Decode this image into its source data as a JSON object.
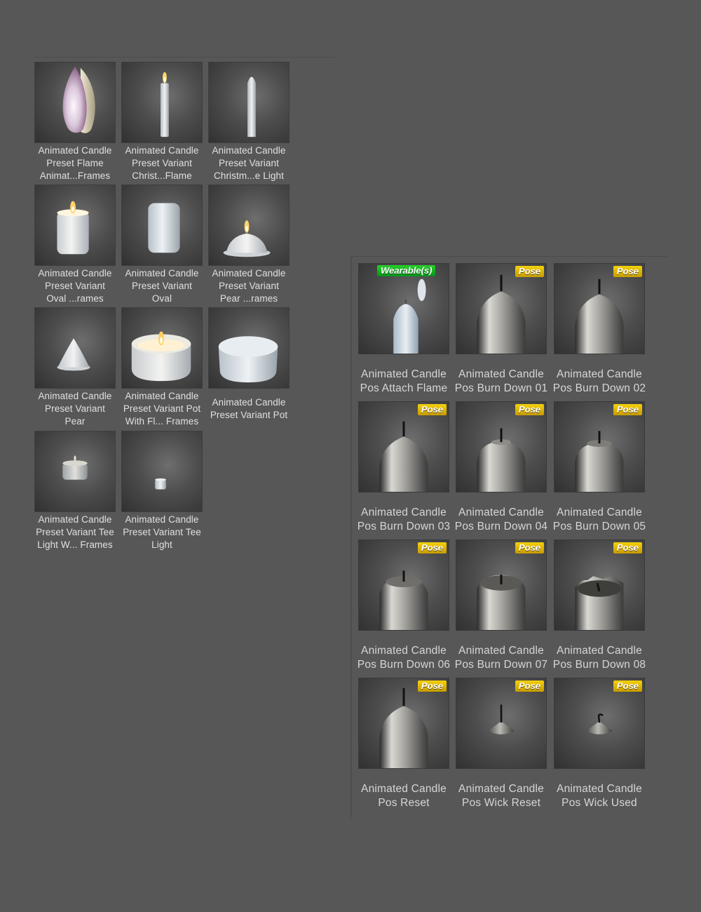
{
  "badge_colors": {
    "pose": "#e0b400",
    "wearable": "#17b21f"
  },
  "left_items": [
    {
      "line1": "Animated Candle",
      "line2": "Preset Flame",
      "line3": "Animat...Frames",
      "icon": "flame-icon"
    },
    {
      "line1": "Animated Candle",
      "line2": "Preset Variant",
      "line3": "Christ...Flame",
      "icon": "christmas-candle-flame-icon"
    },
    {
      "line1": "Animated Candle",
      "line2": "Preset Variant",
      "line3": "Christm...e Light",
      "icon": "christmas-candle-icon"
    },
    {
      "line1": "Animated Candle",
      "line2": "Preset Variant",
      "line3": "Oval ...rames",
      "icon": "oval-candle-lit-icon"
    },
    {
      "line1": "Animated Candle",
      "line2": "Preset Variant",
      "line3": "Oval",
      "icon": "oval-candle-icon"
    },
    {
      "line1": "Animated Candle",
      "line2": "Preset Variant",
      "line3": "Pear ...rames",
      "icon": "pear-candle-lit-icon"
    },
    {
      "line1": "Animated Candle",
      "line2": "Preset Variant",
      "line3": "Pear",
      "icon": "pear-candle-icon"
    },
    {
      "line1": "Animated Candle",
      "line2": "Preset Variant Pot",
      "line3": "With Fl... Frames",
      "icon": "pot-candle-lit-icon"
    },
    {
      "line1": "Animated Candle",
      "line2": "Preset Variant Pot",
      "line3": "",
      "icon": "pot-candle-icon"
    },
    {
      "line1": "Animated Candle",
      "line2": "Preset Variant Tee",
      "line3": "Light W... Frames",
      "icon": "tealight-lit-icon"
    },
    {
      "line1": "Animated Candle",
      "line2": "Preset Variant Tee",
      "line3": "Light",
      "icon": "tealight-icon"
    }
  ],
  "right_items": [
    {
      "line1": "Animated Candle",
      "line2": "Pos Attach Flame",
      "badge": "Wearable(s)",
      "icon": "attach-flame-icon"
    },
    {
      "line1": "Animated Candle",
      "line2": "Pos Burn Down 01",
      "badge": "Pose",
      "icon": "burn-down-01-icon"
    },
    {
      "line1": "Animated Candle",
      "line2": "Pos Burn Down 02",
      "badge": "Pose",
      "icon": "burn-down-02-icon"
    },
    {
      "line1": "Animated Candle",
      "line2": "Pos Burn Down 03",
      "badge": "Pose",
      "icon": "burn-down-03-icon"
    },
    {
      "line1": "Animated Candle",
      "line2": "Pos Burn Down 04",
      "badge": "Pose",
      "icon": "burn-down-04-icon"
    },
    {
      "line1": "Animated Candle",
      "line2": "Pos Burn Down 05",
      "badge": "Pose",
      "icon": "burn-down-05-icon"
    },
    {
      "line1": "Animated Candle",
      "line2": "Pos Burn Down 06",
      "badge": "Pose",
      "icon": "burn-down-06-icon"
    },
    {
      "line1": "Animated Candle",
      "line2": "Pos Burn Down 07",
      "badge": "Pose",
      "icon": "burn-down-07-icon"
    },
    {
      "line1": "Animated Candle",
      "line2": "Pos Burn Down 08",
      "badge": "Pose",
      "icon": "burn-down-08-icon"
    },
    {
      "line1": "Animated Candle",
      "line2": "Pos Reset",
      "badge": "Pose",
      "icon": "pose-reset-icon"
    },
    {
      "line1": "Animated Candle",
      "line2": "Pos Wick Reset",
      "badge": "Pose",
      "icon": "wick-reset-icon"
    },
    {
      "line1": "Animated Candle",
      "line2": "Pos Wick Used",
      "badge": "Pose",
      "icon": "wick-used-icon"
    }
  ]
}
